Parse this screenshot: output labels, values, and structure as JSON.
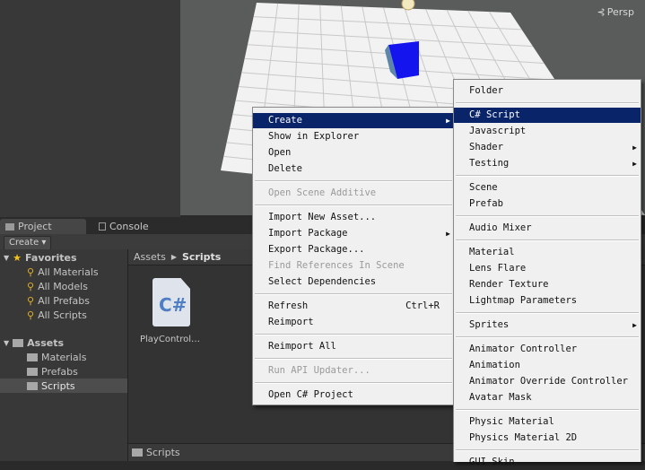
{
  "scene": {
    "persp_label": "Persp"
  },
  "tabs": [
    {
      "label": "Project"
    },
    {
      "label": "Console"
    }
  ],
  "toolbar": {
    "create_label": "Create ▾"
  },
  "tree": {
    "favorites_label": "Favorites",
    "favorites": [
      "All Materials",
      "All Models",
      "All Prefabs",
      "All Scripts"
    ],
    "assets_label": "Assets",
    "assets": [
      "Materials",
      "Prefabs",
      "Scripts"
    ]
  },
  "breadcrumb": {
    "root": "Assets",
    "current": "Scripts"
  },
  "asset": {
    "icon_text": "C#",
    "name": "PlayControl…"
  },
  "bottom_bar": {
    "path": "Scripts"
  },
  "menu1": {
    "items": [
      {
        "label": "Create",
        "shortcut": "",
        "submenu": true,
        "highlighted": true,
        "disabled": false
      },
      {
        "label": "Show in Explorer",
        "shortcut": "",
        "submenu": false,
        "disabled": false
      },
      {
        "label": "Open",
        "shortcut": "",
        "submenu": false,
        "disabled": false
      },
      {
        "label": "Delete",
        "shortcut": "",
        "submenu": false,
        "disabled": false
      },
      {
        "label": "Open Scene Additive",
        "shortcut": "",
        "submenu": false,
        "disabled": true
      },
      {
        "label": "Import New Asset...",
        "shortcut": "",
        "submenu": false,
        "disabled": false
      },
      {
        "label": "Import Package",
        "shortcut": "",
        "submenu": true,
        "disabled": false
      },
      {
        "label": "Export Package...",
        "shortcut": "",
        "submenu": false,
        "disabled": false
      },
      {
        "label": "Find References In Scene",
        "shortcut": "",
        "submenu": false,
        "disabled": true
      },
      {
        "label": "Select Dependencies",
        "shortcut": "",
        "submenu": false,
        "disabled": false
      },
      {
        "label": "Refresh",
        "shortcut": "Ctrl+R",
        "submenu": false,
        "disabled": false
      },
      {
        "label": "Reimport",
        "shortcut": "",
        "submenu": false,
        "disabled": false
      },
      {
        "label": "Reimport All",
        "shortcut": "",
        "submenu": false,
        "disabled": false
      },
      {
        "label": "Run API Updater...",
        "shortcut": "",
        "submenu": false,
        "disabled": true
      },
      {
        "label": "Open C# Project",
        "shortcut": "",
        "submenu": false,
        "disabled": false
      }
    ]
  },
  "menu2": {
    "items": [
      {
        "label": "Folder",
        "submenu": false,
        "highlighted": false
      },
      {
        "label": "C# Script",
        "submenu": false,
        "highlighted": true
      },
      {
        "label": "Javascript",
        "submenu": false
      },
      {
        "label": "Shader",
        "submenu": true
      },
      {
        "label": "Testing",
        "submenu": true
      },
      {
        "label": "Scene",
        "submenu": false
      },
      {
        "label": "Prefab",
        "submenu": false
      },
      {
        "label": "Audio Mixer",
        "submenu": false
      },
      {
        "label": "Material",
        "submenu": false
      },
      {
        "label": "Lens Flare",
        "submenu": false
      },
      {
        "label": "Render Texture",
        "submenu": false
      },
      {
        "label": "Lightmap Parameters",
        "submenu": false
      },
      {
        "label": "Sprites",
        "submenu": true
      },
      {
        "label": "Animator Controller",
        "submenu": false
      },
      {
        "label": "Animation",
        "submenu": false
      },
      {
        "label": "Animator Override Controller",
        "submenu": false
      },
      {
        "label": "Avatar Mask",
        "submenu": false
      },
      {
        "label": "Physic Material",
        "submenu": false
      },
      {
        "label": "Physics Material 2D",
        "submenu": false
      },
      {
        "label": "GUI Skin",
        "submenu": false
      }
    ]
  },
  "colors": {
    "highlight": "#0a246a",
    "menu_bg": "#f0f0f0",
    "cube": "#1010ee"
  }
}
